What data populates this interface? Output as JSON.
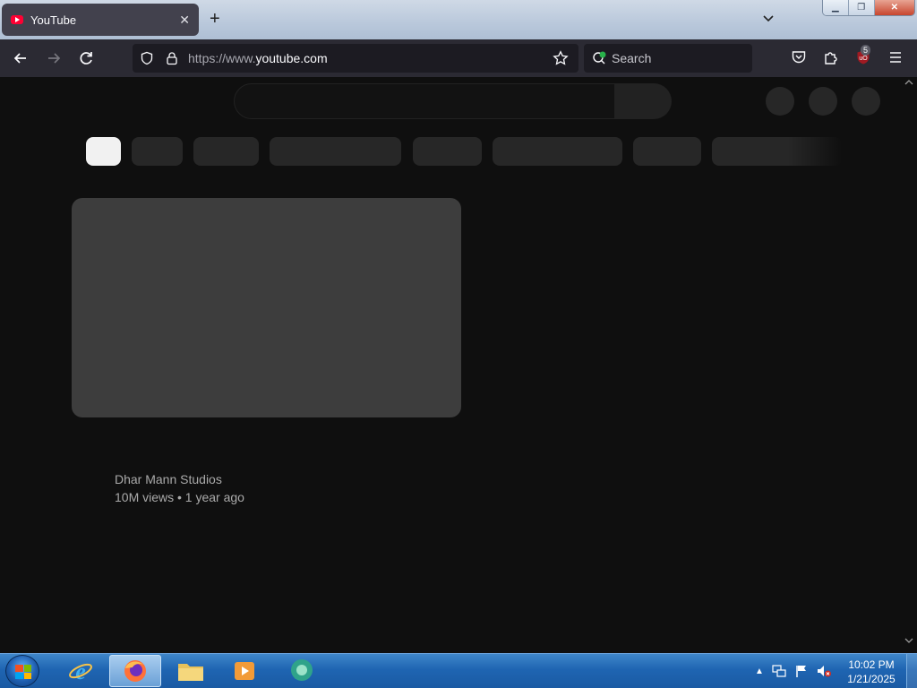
{
  "browser": {
    "tab": {
      "title": "YouTube",
      "close": "✕"
    },
    "new_tab": "+",
    "url": {
      "prefix": "https://www.",
      "domain": "youtube.com"
    },
    "search_placeholder": "Search",
    "extension_badge": "5"
  },
  "page": {
    "video": {
      "channel": "Dhar Mann Studios",
      "meta": "10M views • 1 year ago"
    }
  },
  "taskbar": {
    "time": "10:02 PM",
    "date": "1/21/2025"
  },
  "colors": {
    "page_bg": "#0f0f0f",
    "chip_bg": "#272727",
    "chip_active": "#f1f1f1",
    "thumb_placeholder": "#3d3d3d",
    "browser_toolbar": "#2b2a33"
  }
}
